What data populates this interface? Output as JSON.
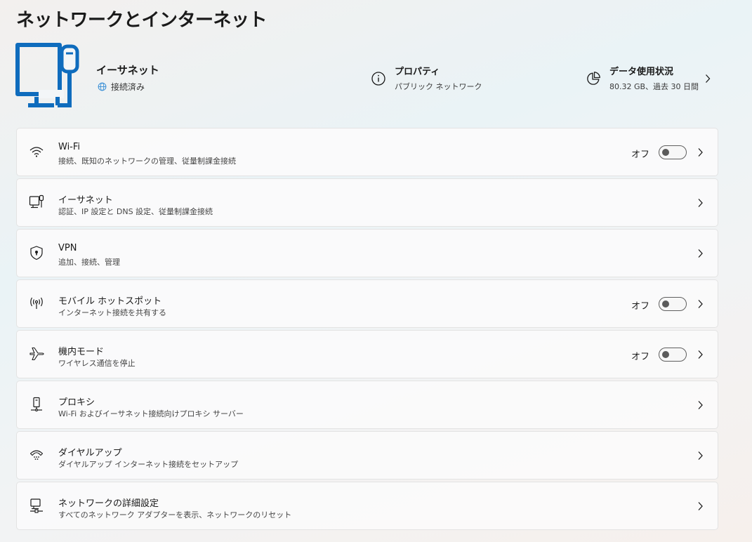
{
  "page": {
    "title": "ネットワークとインターネット"
  },
  "hero": {
    "name": "イーサネット",
    "status": "接続済み",
    "properties": {
      "title": "プロパティ",
      "subtitle": "パブリック ネットワーク"
    },
    "data_usage": {
      "title": "データ使用状況",
      "subtitle": "80.32 GB、過去 30 日間"
    }
  },
  "items": [
    {
      "title": "Wi-Fi",
      "subtitle": "接続、既知のネットワークの管理、従量制課金接続",
      "state": "オフ",
      "toggle_on": false,
      "icon": "wifi-icon"
    },
    {
      "title": "イーサネット",
      "subtitle": "認証、IP 設定と DNS 設定、従量制課金接続",
      "icon": "ethernet-icon"
    },
    {
      "title": "VPN",
      "subtitle": "追加、接続、管理",
      "icon": "vpn-shield-icon"
    },
    {
      "title": "モバイル ホットスポット",
      "subtitle": "インターネット接続を共有する",
      "state": "オフ",
      "toggle_on": false,
      "icon": "hotspot-icon"
    },
    {
      "title": "機内モード",
      "subtitle": "ワイヤレス通信を停止",
      "state": "オフ",
      "toggle_on": false,
      "icon": "airplane-icon"
    },
    {
      "title": "プロキシ",
      "subtitle": "Wi-Fi およびイーサネット接続向けプロキシ サーバー",
      "icon": "proxy-icon"
    },
    {
      "title": "ダイヤルアップ",
      "subtitle": "ダイヤルアップ インターネット接続をセットアップ",
      "icon": "dialup-icon"
    },
    {
      "title": "ネットワークの詳細設定",
      "subtitle": "すべてのネットワーク アダプターを表示、ネットワークのリセット",
      "icon": "advanced-network-icon"
    }
  ],
  "colors": {
    "accent": "#0f6cbd",
    "globe": "#3a8fd6"
  }
}
